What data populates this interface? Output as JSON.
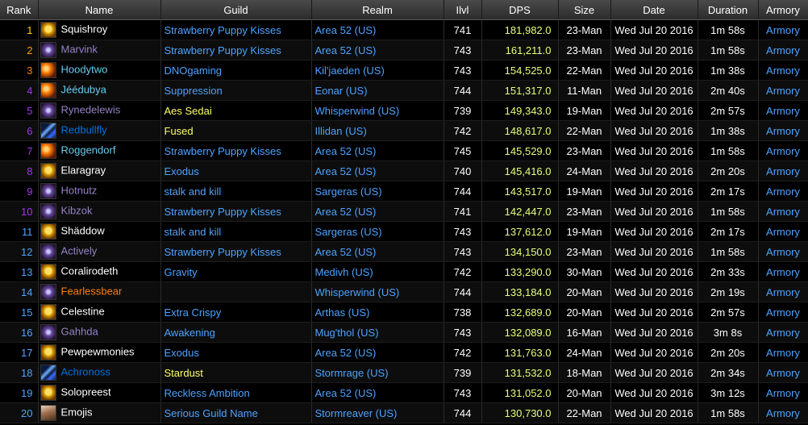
{
  "headers": [
    "Rank",
    "Name",
    "Guild",
    "Realm",
    "Ilvl",
    "DPS",
    "Size",
    "Date",
    "Duration",
    "Armory"
  ],
  "colors": {
    "rank": "#ffd700",
    "dps": "#e6ff7a",
    "link": "#4da3ff",
    "white": "#ffffff",
    "priest": "#ffffff",
    "mage": "#69ccf0",
    "warlock": "#9482c9",
    "shaman": "#0070de",
    "druid": "#ff7d0a",
    "warrior": "#c79c6e"
  },
  "rows": [
    {
      "rank": "1",
      "name": "Squishroy",
      "name_color": "#ffffff",
      "icon": "priest-icon",
      "guild": "Strawberry Puppy Kisses",
      "guild_color": "#4da3ff",
      "realm": "Area 52 (US)",
      "ilvl": "741",
      "dps": "181,982.0",
      "size": "23-Man",
      "date": "Wed Jul 20 2016",
      "duration": "1m 58s",
      "armory": "Armory",
      "rank_color": "#ffd700"
    },
    {
      "rank": "2",
      "name": "Marvink",
      "name_color": "#9482c9",
      "icon": "shadow-icon",
      "guild": "Strawberry Puppy Kisses",
      "guild_color": "#4da3ff",
      "realm": "Area 52 (US)",
      "ilvl": "743",
      "dps": "161,211.0",
      "size": "23-Man",
      "date": "Wed Jul 20 2016",
      "duration": "1m 58s",
      "armory": "Armory",
      "rank_color": "#ff9a00"
    },
    {
      "rank": "3",
      "name": "Hoodytwo",
      "name_color": "#69ccf0",
      "icon": "fire-icon",
      "guild": "DNOgaming",
      "guild_color": "#4da3ff",
      "realm": "Kil'jaeden (US)",
      "ilvl": "743",
      "dps": "154,525.0",
      "size": "22-Man",
      "date": "Wed Jul 20 2016",
      "duration": "1m 38s",
      "armory": "Armory",
      "rank_color": "#ff7d0a"
    },
    {
      "rank": "4",
      "name": "Jéédubya",
      "name_color": "#69ccf0",
      "icon": "fire-icon",
      "guild": "Suppression",
      "guild_color": "#4da3ff",
      "realm": "Eonar (US)",
      "ilvl": "744",
      "dps": "151,317.0",
      "size": "11-Man",
      "date": "Wed Jul 20 2016",
      "duration": "2m 40s",
      "armory": "Armory",
      "rank_color": "#a335ee"
    },
    {
      "rank": "5",
      "name": "Rynedelewis",
      "name_color": "#9482c9",
      "icon": "shadow-icon",
      "guild": "Aes Sedai",
      "guild_color": "#ffff66",
      "realm": "Whisperwind (US)",
      "ilvl": "739",
      "dps": "149,343.0",
      "size": "19-Man",
      "date": "Wed Jul 20 2016",
      "duration": "2m 57s",
      "armory": "Armory",
      "rank_color": "#a335ee"
    },
    {
      "rank": "6",
      "name": "Redbullfly",
      "name_color": "#0070de",
      "icon": "storm-icon",
      "guild": "Fused",
      "guild_color": "#ffff66",
      "realm": "Illidan (US)",
      "ilvl": "742",
      "dps": "148,617.0",
      "size": "22-Man",
      "date": "Wed Jul 20 2016",
      "duration": "1m 38s",
      "armory": "Armory",
      "rank_color": "#a335ee"
    },
    {
      "rank": "7",
      "name": "Roggendorf",
      "name_color": "#69ccf0",
      "icon": "fire-icon",
      "guild": "Strawberry Puppy Kisses",
      "guild_color": "#4da3ff",
      "realm": "Area 52 (US)",
      "ilvl": "745",
      "dps": "145,529.0",
      "size": "23-Man",
      "date": "Wed Jul 20 2016",
      "duration": "1m 58s",
      "armory": "Armory",
      "rank_color": "#a335ee"
    },
    {
      "rank": "8",
      "name": "Elaragray",
      "name_color": "#ffffff",
      "icon": "priest-icon",
      "guild": "Exodus",
      "guild_color": "#4da3ff",
      "realm": "Area 52 (US)",
      "ilvl": "740",
      "dps": "145,416.0",
      "size": "24-Man",
      "date": "Wed Jul 20 2016",
      "duration": "2m 20s",
      "armory": "Armory",
      "rank_color": "#a335ee"
    },
    {
      "rank": "9",
      "name": "Hotnutz",
      "name_color": "#9482c9",
      "icon": "shadow-icon",
      "guild": "stalk and kill",
      "guild_color": "#4da3ff",
      "realm": "Sargeras (US)",
      "ilvl": "744",
      "dps": "143,517.0",
      "size": "19-Man",
      "date": "Wed Jul 20 2016",
      "duration": "2m 17s",
      "armory": "Armory",
      "rank_color": "#a335ee"
    },
    {
      "rank": "10",
      "name": "Kibzok",
      "name_color": "#9482c9",
      "icon": "shadow-icon",
      "guild": "Strawberry Puppy Kisses",
      "guild_color": "#4da3ff",
      "realm": "Area 52 (US)",
      "ilvl": "741",
      "dps": "142,447.0",
      "size": "23-Man",
      "date": "Wed Jul 20 2016",
      "duration": "1m 58s",
      "armory": "Armory",
      "rank_color": "#a335ee"
    },
    {
      "rank": "11",
      "name": "Shäddow",
      "name_color": "#ffffff",
      "icon": "priest-icon",
      "guild": "stalk and kill",
      "guild_color": "#4da3ff",
      "realm": "Sargeras (US)",
      "ilvl": "743",
      "dps": "137,612.0",
      "size": "19-Man",
      "date": "Wed Jul 20 2016",
      "duration": "2m 17s",
      "armory": "Armory",
      "rank_color": "#4da3ff"
    },
    {
      "rank": "12",
      "name": "Actively",
      "name_color": "#9482c9",
      "icon": "shadow-icon",
      "guild": "Strawberry Puppy Kisses",
      "guild_color": "#4da3ff",
      "realm": "Area 52 (US)",
      "ilvl": "743",
      "dps": "134,150.0",
      "size": "23-Man",
      "date": "Wed Jul 20 2016",
      "duration": "1m 58s",
      "armory": "Armory",
      "rank_color": "#4da3ff"
    },
    {
      "rank": "13",
      "name": "Coralirodeth",
      "name_color": "#ffffff",
      "icon": "priest-icon",
      "guild": "Gravity",
      "guild_color": "#4da3ff",
      "realm": "Medivh (US)",
      "ilvl": "742",
      "dps": "133,290.0",
      "size": "30-Man",
      "date": "Wed Jul 20 2016",
      "duration": "2m 33s",
      "armory": "Armory",
      "rank_color": "#4da3ff"
    },
    {
      "rank": "14",
      "name": "Fearlessbear",
      "name_color": "#ff7d0a",
      "icon": "shadow-icon",
      "guild": "",
      "guild_color": "#4da3ff",
      "realm": "Whisperwind (US)",
      "ilvl": "744",
      "dps": "133,184.0",
      "size": "20-Man",
      "date": "Wed Jul 20 2016",
      "duration": "2m 19s",
      "armory": "Armory",
      "rank_color": "#4da3ff"
    },
    {
      "rank": "15",
      "name": "Celestine",
      "name_color": "#ffffff",
      "icon": "priest-icon",
      "guild": "Extra Crispy",
      "guild_color": "#4da3ff",
      "realm": "Arthas (US)",
      "ilvl": "738",
      "dps": "132,689.0",
      "size": "20-Man",
      "date": "Wed Jul 20 2016",
      "duration": "2m 57s",
      "armory": "Armory",
      "rank_color": "#4da3ff"
    },
    {
      "rank": "16",
      "name": "Gahhda",
      "name_color": "#9482c9",
      "icon": "shadow-icon",
      "guild": "Awakening",
      "guild_color": "#4da3ff",
      "realm": "Mug'thol (US)",
      "ilvl": "743",
      "dps": "132,089.0",
      "size": "16-Man",
      "date": "Wed Jul 20 2016",
      "duration": "3m 8s",
      "armory": "Armory",
      "rank_color": "#4da3ff"
    },
    {
      "rank": "17",
      "name": "Pewpewmonies",
      "name_color": "#ffffff",
      "icon": "priest-icon",
      "guild": "Exodus",
      "guild_color": "#4da3ff",
      "realm": "Area 52 (US)",
      "ilvl": "742",
      "dps": "131,763.0",
      "size": "24-Man",
      "date": "Wed Jul 20 2016",
      "duration": "2m 20s",
      "armory": "Armory",
      "rank_color": "#4da3ff"
    },
    {
      "rank": "18",
      "name": "Achronoss",
      "name_color": "#0070de",
      "icon": "storm-icon",
      "guild": "Stardust",
      "guild_color": "#ffff66",
      "realm": "Stormrage (US)",
      "ilvl": "739",
      "dps": "131,532.0",
      "size": "18-Man",
      "date": "Wed Jul 20 2016",
      "duration": "2m 34s",
      "armory": "Armory",
      "rank_color": "#4da3ff"
    },
    {
      "rank": "19",
      "name": "Solopreest",
      "name_color": "#ffffff",
      "icon": "priest-icon",
      "guild": "Reckless Ambition",
      "guild_color": "#4da3ff",
      "realm": "Area 52 (US)",
      "ilvl": "743",
      "dps": "131,052.0",
      "size": "20-Man",
      "date": "Wed Jul 20 2016",
      "duration": "3m 12s",
      "armory": "Armory",
      "rank_color": "#4da3ff"
    },
    {
      "rank": "20",
      "name": "Emojis",
      "name_color": "#ffffff",
      "icon": "warrior-icon",
      "guild": "Serious Guild Name",
      "guild_color": "#4da3ff",
      "realm": "Stormreaver (US)",
      "ilvl": "744",
      "dps": "130,730.0",
      "size": "22-Man",
      "date": "Wed Jul 20 2016",
      "duration": "1m 58s",
      "armory": "Armory",
      "rank_color": "#4da3ff"
    }
  ]
}
